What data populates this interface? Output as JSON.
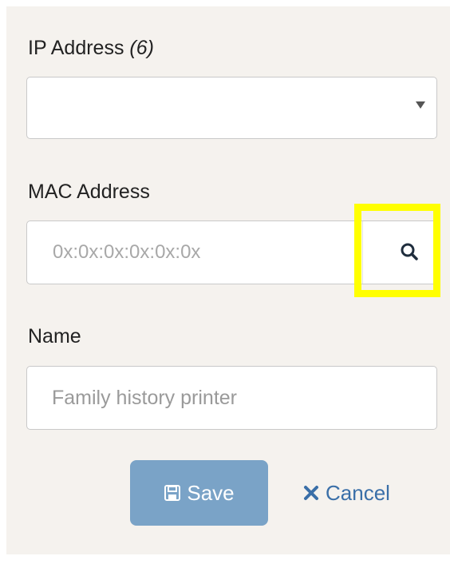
{
  "form": {
    "ip_address": {
      "label": "IP Address",
      "count": "(6)",
      "value": ""
    },
    "mac_address": {
      "label": "MAC Address",
      "placeholder": "0x:0x:0x:0x:0x:0x",
      "value": "",
      "search_icon": "search-icon"
    },
    "name": {
      "label": "Name",
      "placeholder": "Family history printer",
      "value": ""
    },
    "actions": {
      "save_label": "Save",
      "save_icon": "floppy-disk-icon",
      "cancel_label": "Cancel",
      "cancel_icon": "x-mark-icon"
    }
  },
  "colors": {
    "panel_background": "#f5f2ee",
    "save_button": "#7aa3c7",
    "cancel_link": "#3a6fa8",
    "highlight": "#ffff00"
  }
}
